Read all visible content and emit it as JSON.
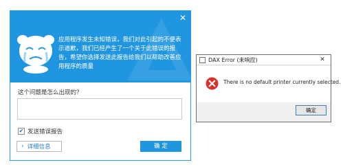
{
  "crash_dialog": {
    "message": "应用程序发生未知错误，我们对此引起的不便表示道歉，我们已经产生了一个关于此错误的报告，希望你选择发送此报告给我们以帮助改善应用程序的质量",
    "question_label": "这个问题是怎么出现的？",
    "answer_value": "",
    "send_report_label": "发送错误报告",
    "send_report_checked": true,
    "details_button_label": "详细信息",
    "ok_button_label": "确 定",
    "accent_color": "#2196e0"
  },
  "dax_dialog": {
    "title": "DAX Error (未响应)",
    "message": "There is no default printer currently selected.",
    "ok_button_label": "确定",
    "error_color": "#d9312b"
  }
}
